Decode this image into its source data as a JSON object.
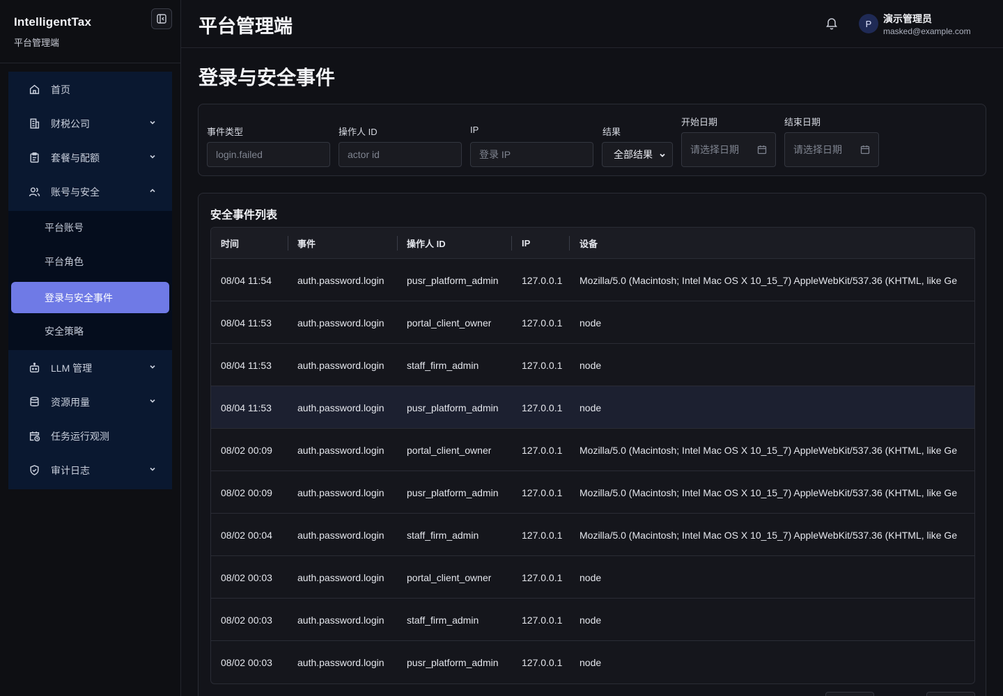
{
  "brand": {
    "title": "IntelligentTax",
    "subtitle": "平台管理端"
  },
  "sidebar": {
    "items": [
      {
        "label": "首页",
        "icon": "home-icon",
        "has_chevron": false
      },
      {
        "label": "财税公司",
        "icon": "building-icon",
        "has_chevron": true,
        "expanded": false
      },
      {
        "label": "套餐与配额",
        "icon": "clipboard-icon",
        "has_chevron": true,
        "expanded": false
      },
      {
        "label": "账号与安全",
        "icon": "users-icon",
        "has_chevron": true,
        "expanded": true
      },
      {
        "label": "LLM 管理",
        "icon": "bot-icon",
        "has_chevron": true,
        "expanded": false
      },
      {
        "label": "资源用量",
        "icon": "database-icon",
        "has_chevron": true,
        "expanded": false
      },
      {
        "label": "任务运行观测",
        "icon": "calendar-clock-icon",
        "has_chevron": false
      },
      {
        "label": "审计日志",
        "icon": "shield-check-icon",
        "has_chevron": true,
        "expanded": false
      }
    ],
    "subitems": [
      {
        "label": "平台账号",
        "active": false
      },
      {
        "label": "平台角色",
        "active": false
      },
      {
        "label": "登录与安全事件",
        "active": true
      },
      {
        "label": "安全策略",
        "active": false
      }
    ]
  },
  "header": {
    "title": "平台管理端",
    "user": {
      "avatar_letter": "P",
      "name": "演示管理员",
      "email": "masked@example.com"
    }
  },
  "page": {
    "title": "登录与安全事件"
  },
  "filters": {
    "event_type": {
      "label": "事件类型",
      "placeholder": "login.failed"
    },
    "actor_id": {
      "label": "操作人 ID",
      "placeholder": "actor id"
    },
    "ip": {
      "label": "IP",
      "placeholder": "登录 IP"
    },
    "result": {
      "label": "结果",
      "value": "全部结果"
    },
    "start_date": {
      "label": "开始日期",
      "placeholder": "请选择日期"
    },
    "end_date": {
      "label": "结束日期",
      "placeholder": "请选择日期"
    }
  },
  "table": {
    "title": "安全事件列表",
    "columns": [
      "时间",
      "事件",
      "操作人 ID",
      "IP",
      "设备"
    ],
    "rows": [
      {
        "time": "08/04 11:54",
        "event": "auth.password.login",
        "actor": "pusr_platform_admin",
        "ip": "127.0.0.1",
        "device": "Mozilla/5.0 (Macintosh; Intel Mac OS X 10_15_7) AppleWebKit/537.36 (KHTML, like Ge"
      },
      {
        "time": "08/04 11:53",
        "event": "auth.password.login",
        "actor": "portal_client_owner",
        "ip": "127.0.0.1",
        "device": "node"
      },
      {
        "time": "08/04 11:53",
        "event": "auth.password.login",
        "actor": "staff_firm_admin",
        "ip": "127.0.0.1",
        "device": "node"
      },
      {
        "time": "08/04 11:53",
        "event": "auth.password.login",
        "actor": "pusr_platform_admin",
        "ip": "127.0.0.1",
        "device": "node"
      },
      {
        "time": "08/02 00:09",
        "event": "auth.password.login",
        "actor": "portal_client_owner",
        "ip": "127.0.0.1",
        "device": "Mozilla/5.0 (Macintosh; Intel Mac OS X 10_15_7) AppleWebKit/537.36 (KHTML, like Ge"
      },
      {
        "time": "08/02 00:09",
        "event": "auth.password.login",
        "actor": "pusr_platform_admin",
        "ip": "127.0.0.1",
        "device": "Mozilla/5.0 (Macintosh; Intel Mac OS X 10_15_7) AppleWebKit/537.36 (KHTML, like Ge"
      },
      {
        "time": "08/02 00:04",
        "event": "auth.password.login",
        "actor": "staff_firm_admin",
        "ip": "127.0.0.1",
        "device": "Mozilla/5.0 (Macintosh; Intel Mac OS X 10_15_7) AppleWebKit/537.36 (KHTML, like Ge"
      },
      {
        "time": "08/02 00:03",
        "event": "auth.password.login",
        "actor": "portal_client_owner",
        "ip": "127.0.0.1",
        "device": "node"
      },
      {
        "time": "08/02 00:03",
        "event": "auth.password.login",
        "actor": "staff_firm_admin",
        "ip": "127.0.0.1",
        "device": "node"
      },
      {
        "time": "08/02 00:03",
        "event": "auth.password.login",
        "actor": "pusr_platform_admin",
        "ip": "127.0.0.1",
        "device": "node"
      }
    ]
  },
  "colors": {
    "accent": "#6f7ae6",
    "nav_bg": "#0a1830",
    "page_bg": "#101116",
    "card_bg": "#13141a"
  }
}
